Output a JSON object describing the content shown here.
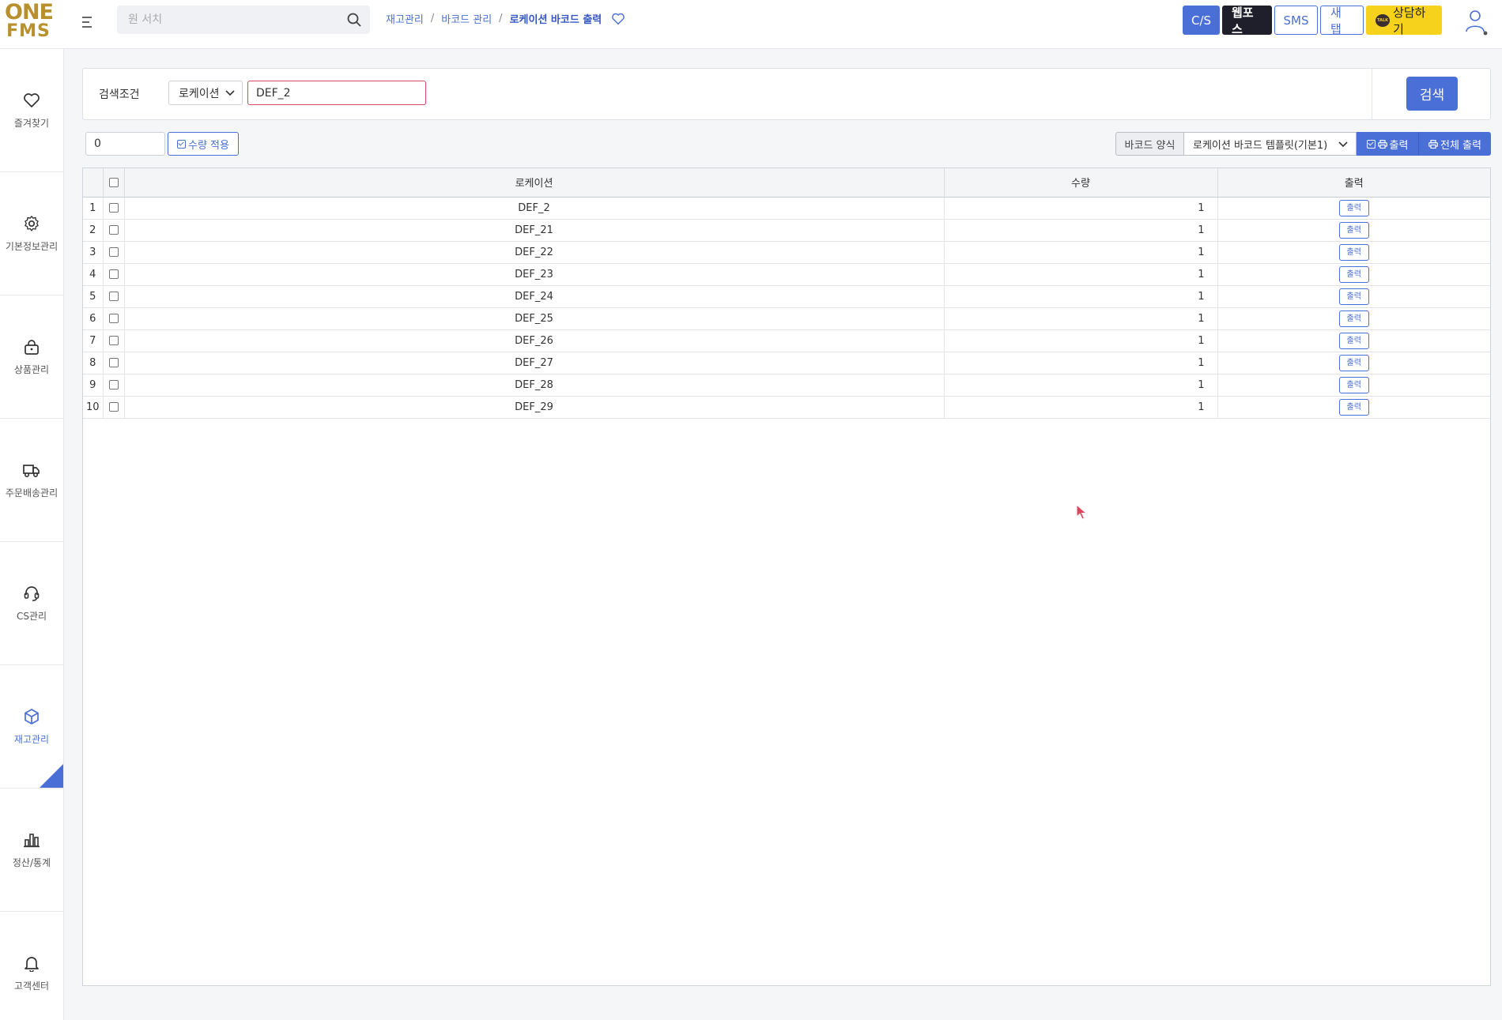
{
  "app": {
    "logo_line1": "ONE",
    "logo_line2": "FMS"
  },
  "header": {
    "search_placeholder": "원 서치",
    "breadcrumb": [
      "재고관리",
      "바코드 관리",
      "로케이션 바코드 출력"
    ],
    "buttons": {
      "cs": "C/S",
      "webpos": "웹포스",
      "sms": "SMS",
      "newtab": "새 탭",
      "talk": "상담하기",
      "talk_badge": "TALK"
    }
  },
  "sidebar": {
    "items": [
      {
        "label": "즐겨찾기",
        "icon": "heart-icon"
      },
      {
        "label": "기본정보관리",
        "icon": "gear-icon"
      },
      {
        "label": "상품관리",
        "icon": "bag-icon"
      },
      {
        "label": "주문배송관리",
        "icon": "truck-icon"
      },
      {
        "label": "CS관리",
        "icon": "headset-icon"
      },
      {
        "label": "재고관리",
        "icon": "box-icon",
        "active": true
      },
      {
        "label": "정산/통계",
        "icon": "bar-chart-icon"
      },
      {
        "label": "고객센터",
        "icon": "bell-icon"
      }
    ]
  },
  "search_panel": {
    "label": "검색조건",
    "select_value": "로케이션",
    "input_value": "DEF_2",
    "search_button": "검색"
  },
  "toolbar": {
    "qty_value": "0",
    "apply_button": "수량 적용",
    "barcode_label": "바코드 양식",
    "template_value": "로케이션 바코드 템플릿(기본1)",
    "print_button": "출력",
    "print_all_button": "전체 출력"
  },
  "grid": {
    "headers": {
      "location": "로케이션",
      "qty": "수량",
      "print": "출력"
    },
    "row_print_label": "출력",
    "rows": [
      {
        "no": "1",
        "location": "DEF_2",
        "qty": "1"
      },
      {
        "no": "2",
        "location": "DEF_21",
        "qty": "1"
      },
      {
        "no": "3",
        "location": "DEF_22",
        "qty": "1"
      },
      {
        "no": "4",
        "location": "DEF_23",
        "qty": "1"
      },
      {
        "no": "5",
        "location": "DEF_24",
        "qty": "1"
      },
      {
        "no": "6",
        "location": "DEF_25",
        "qty": "1"
      },
      {
        "no": "7",
        "location": "DEF_26",
        "qty": "1"
      },
      {
        "no": "8",
        "location": "DEF_27",
        "qty": "1"
      },
      {
        "no": "9",
        "location": "DEF_28",
        "qty": "1"
      },
      {
        "no": "10",
        "location": "DEF_29",
        "qty": "1"
      }
    ]
  },
  "colors": {
    "accent": "#4a6fd6",
    "logo_gold": "#b8902e",
    "talk_yellow": "#f7d21c",
    "dark": "#1f1f2b"
  }
}
